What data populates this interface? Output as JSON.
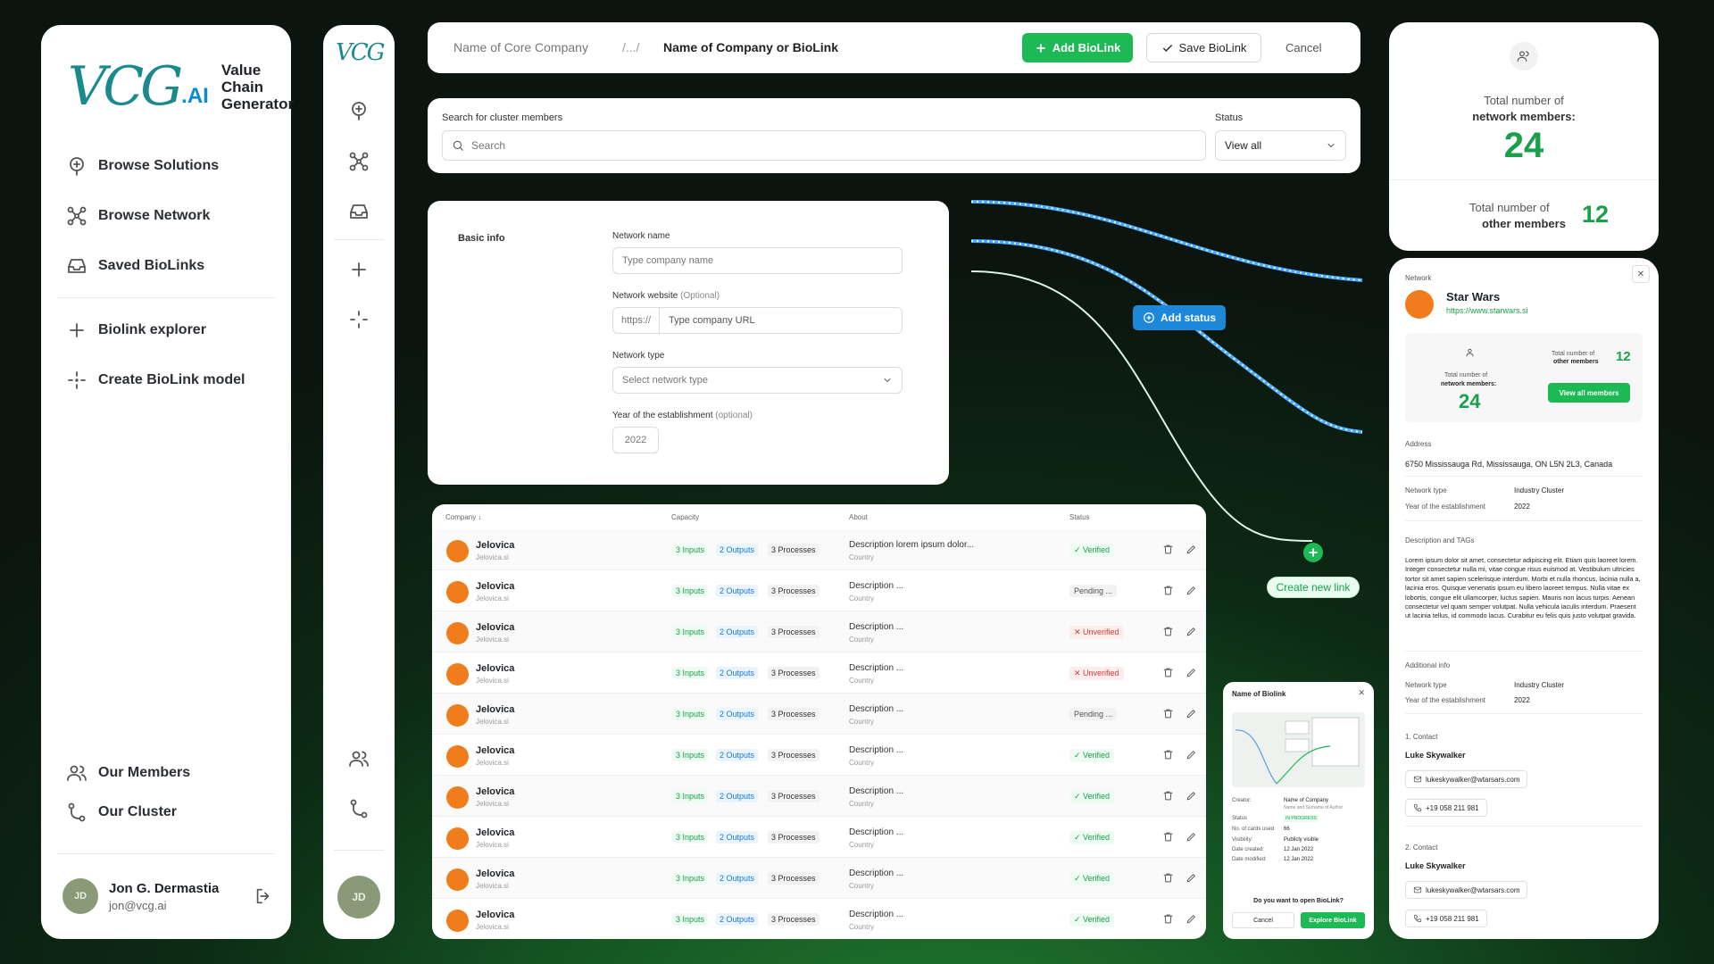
{
  "brand": {
    "mark": "VCG",
    "ai": ".AI",
    "name_line1": "Value",
    "name_line2": "Chain",
    "name_line3": "Generator",
    "rail_mark": "VCG"
  },
  "nav": {
    "browse_solutions": "Browse Solutions",
    "browse_network": "Browse Network",
    "saved_biolinks": "Saved BioLinks",
    "biolink_explorer": "Biolink explorer",
    "create_model": "Create BioLink model",
    "our_members": "Our Members",
    "our_cluster": "Our Cluster"
  },
  "user": {
    "initials": "JD",
    "name": "Jon G. Dermastia",
    "email": "jon@vcg.ai"
  },
  "topbar": {
    "core_company": "Name of Core Company",
    "ellipsis": "/.../",
    "current": "Name of Company or BioLink",
    "add_label": "Add BioLink",
    "save_label": "Save BioLink",
    "cancel_label": "Cancel"
  },
  "search": {
    "label": "Search for cluster members",
    "placeholder": "Search",
    "status_label": "Status",
    "status_value": "View all"
  },
  "basic": {
    "section": "Basic info",
    "network_name_label": "Network name",
    "network_name_placeholder": "Type company name",
    "website_label": "Network website",
    "website_optional": "(Optional)",
    "website_prefix": "https://",
    "website_placeholder": "Type company URL",
    "type_label": "Network type",
    "type_placeholder": "Select network type",
    "year_label": "Year of the establishment",
    "year_optional": "(optional)",
    "year_value": "2022"
  },
  "flow": {
    "add_status": "Add status",
    "create_link": "Create new link"
  },
  "table": {
    "headers": {
      "company": "Company",
      "capacity": "Capacity",
      "about": "About",
      "status": "Status"
    },
    "rows": [
      {
        "name": "Jelovica",
        "sub": "Jelovica.si",
        "inputs": "3 Inputs",
        "outputs": "2 Outputs",
        "processes": "3 Processes",
        "desc": "Description lorem ipsum dolor...",
        "country": "Country",
        "status": "✓ Verified",
        "kind": "v"
      },
      {
        "name": "Jelovica",
        "sub": "Jelovica.si",
        "inputs": "3 Inputs",
        "outputs": "2 Outputs",
        "processes": "3 Processes",
        "desc": "Description ...",
        "country": "Country",
        "status": "Pending ...",
        "kind": "p"
      },
      {
        "name": "Jelovica",
        "sub": "Jelovica.si",
        "inputs": "3 Inputs",
        "outputs": "2 Outputs",
        "processes": "3 Processes",
        "desc": "Description ...",
        "country": "Country",
        "status": "✕ Unverified",
        "kind": "u"
      },
      {
        "name": "Jelovica",
        "sub": "Jelovica.si",
        "inputs": "3 Inputs",
        "outputs": "2 Outputs",
        "processes": "3 Processes",
        "desc": "Description ...",
        "country": "Country",
        "status": "✕ Unverified",
        "kind": "u"
      },
      {
        "name": "Jelovica",
        "sub": "Jelovica.si",
        "inputs": "3 Inputs",
        "outputs": "2 Outputs",
        "processes": "3 Processes",
        "desc": "Description ...",
        "country": "Country",
        "status": "Pending ...",
        "kind": "p"
      },
      {
        "name": "Jelovica",
        "sub": "Jelovica.si",
        "inputs": "3 Inputs",
        "outputs": "2 Outputs",
        "processes": "3 Processes",
        "desc": "Description ...",
        "country": "Country",
        "status": "✓ Verified",
        "kind": "v"
      },
      {
        "name": "Jelovica",
        "sub": "Jelovica.si",
        "inputs": "3 Inputs",
        "outputs": "2 Outputs",
        "processes": "3 Processes",
        "desc": "Description ...",
        "country": "Country",
        "status": "✓ Verified",
        "kind": "v"
      },
      {
        "name": "Jelovica",
        "sub": "Jelovica.si",
        "inputs": "3 Inputs",
        "outputs": "2 Outputs",
        "processes": "3 Processes",
        "desc": "Description ...",
        "country": "Country",
        "status": "✓ Verified",
        "kind": "v"
      },
      {
        "name": "Jelovica",
        "sub": "Jelovica.si",
        "inputs": "3 Inputs",
        "outputs": "2 Outputs",
        "processes": "3 Processes",
        "desc": "Description ...",
        "country": "Country",
        "status": "✓ Verified",
        "kind": "v"
      },
      {
        "name": "Jelovica",
        "sub": "Jelovica.si",
        "inputs": "3 Inputs",
        "outputs": "2 Outputs",
        "processes": "3 Processes",
        "desc": "Description ...",
        "country": "Country",
        "status": "✓ Verified",
        "kind": "v"
      }
    ]
  },
  "totals": {
    "members_line1": "Total number of",
    "members_line2": "network members:",
    "members_value": "24",
    "other_line1": "Total number of",
    "other_line2": "other members",
    "other_value": "12"
  },
  "detail": {
    "section": "Network",
    "name": "Star Wars",
    "url": "https://www.starwars.si",
    "mini_other_l1": "Total number of",
    "mini_other_l2": "other members",
    "mini_other_v": "12",
    "view_all": "View all members",
    "mini_members_l1": "Total number of",
    "mini_members_l2": "network members:",
    "mini_members_v": "24",
    "address_label": "Address",
    "address": "6750 Mississauga Rd, Mississauga, ON L5N 2L3, Canada",
    "nt_label": "Network type",
    "nt_value": "Industry Cluster",
    "year_label": "Year of the establishment",
    "year_value": "2022",
    "desc_label": "Description and TAGs",
    "desc": "Lorem ipsum dolor sit amet, consectetur adipiscing elit. Etiam quis laoreet lorem. Integer consectetur nulla mi, vitae congue risus euismod at. Vestibulum ultricies tortor sit amet sapien scelerisque interdum. Morbi et nulla rhoncus, lacinia nulla a, lacinia eros. Quisque venenatis ipsum eu libero laoreet tempus. Nulla vitae ex lobortis, congue elit ullamcorper, luctus sapien. Mauris non lacus turpis. Aenean consectetur vel quam semper volutpat. Nulla vehicula iaculis interdum. Praesent ut lacinia tellus, id commodo lacus. Curabitur eu felis quis justo volutpat gravida.",
    "add_label": "Additional info",
    "add_nt_label": "Network type",
    "add_nt_value": "Industry Cluster",
    "add_year_label": "Year of the establishment",
    "add_year_value": "2022",
    "c1_label": "1. Contact",
    "c1_name": "Luke Skywalker",
    "c1_email": "lukeskywalker@wtarsars.com",
    "c1_phone": "+19 058 211 981",
    "c2_label": "2. Contact",
    "c2_name": "Luke Skywalker",
    "c2_email": "lukeskywalker@wtarsars.com",
    "c2_phone": "+19 058 211 981"
  },
  "modal": {
    "title": "Name of Biolink",
    "creator_k": "Creator:",
    "creator_v": "Name of Company",
    "creator_v2": "Name and Surname of Author",
    "status_k": "Status",
    "status_v": "IN PROGRESS",
    "cards_k": "No. of cards used",
    "cards_v": "66",
    "vis_k": "Visibility:",
    "vis_v": "Publicly visible",
    "created_k": "Date created:",
    "created_v": "12 Jan 2022",
    "modified_k": "Date modified:",
    "modified_v": "12 Jan 2022",
    "question": "Do you want to open BioLink?",
    "cancel": "Cancel",
    "explore": "Explore BioLink"
  }
}
